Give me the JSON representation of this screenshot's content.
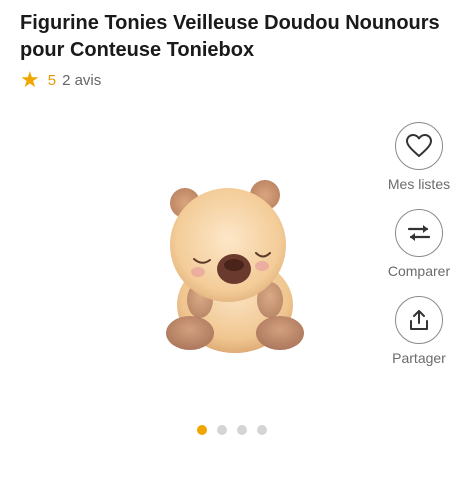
{
  "product": {
    "title": "Figurine Tonies Veilleuse Doudou Nounours pour Conteuse Toniebox",
    "rating": {
      "star_icon": "star-icon",
      "score": "5",
      "reviews_label": "2 avis",
      "star_color": "#f0a500"
    }
  },
  "actions": [
    {
      "icon": "heart-icon",
      "label": "Mes listes"
    },
    {
      "icon": "compare-arrows-icon",
      "label": "Comparer"
    },
    {
      "icon": "share-icon",
      "label": "Partager"
    }
  ],
  "carousel": {
    "total_slides": 4,
    "active_index": 0,
    "active_color": "#f0a500",
    "inactive_color": "#d4d4d4"
  }
}
